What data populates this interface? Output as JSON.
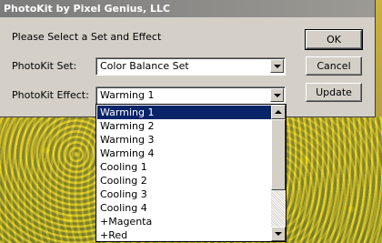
{
  "window": {
    "title": "PhotoKit by Pixel Genius, LLC"
  },
  "prompt": "Please Select a Set and Effect",
  "set_field": {
    "label": "PhotoKit Set:",
    "value": "Color Balance Set"
  },
  "effect_field": {
    "label": "PhotoKit Effect:",
    "value": "Warming 1"
  },
  "buttons": {
    "ok": "OK",
    "cancel": "Cancel",
    "update": "Update"
  },
  "effect_options": [
    "Warming 1",
    "Warming 2",
    "Warming 3",
    "Warming 4",
    "Cooling 1",
    "Cooling 2",
    "Cooling 3",
    "Cooling 4",
    "+Magenta",
    "+Red"
  ],
  "selected_option_index": 0,
  "colors": {
    "selection": "#0a246a",
    "dialog_bg": "#d4d0c8"
  }
}
